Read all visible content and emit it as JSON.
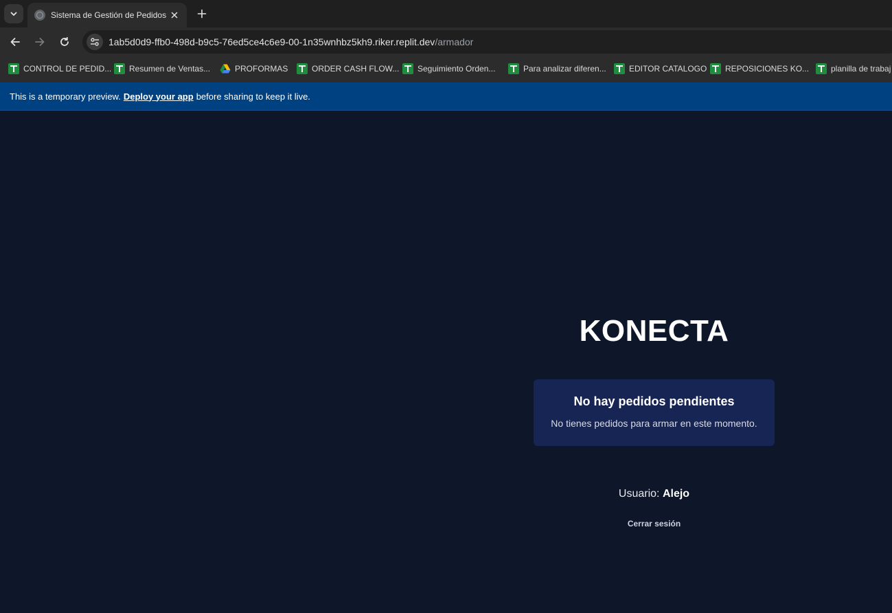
{
  "browser": {
    "tab": {
      "title": "Sistema de Gestión de Pedidos"
    },
    "address": {
      "host": "1ab5d0d9-ffb0-498d-b9c5-76ed5ce4c6e9-00-1n35wnhbz5kh9.riker.replit.dev",
      "path": "/armador"
    },
    "bookmarks": [
      {
        "label": "CONTROL DE PEDID...",
        "icon": "sheets-icon"
      },
      {
        "label": "Resumen de Ventas...",
        "icon": "sheets-icon"
      },
      {
        "label": "PROFORMAS",
        "icon": "drive-icon"
      },
      {
        "label": "ORDER CASH FLOW...",
        "icon": "sheets-icon"
      },
      {
        "label": "Seguimiento Orden...",
        "icon": "sheets-icon"
      },
      {
        "label": "Para analizar diferen...",
        "icon": "sheets-icon"
      },
      {
        "label": "EDITOR CATALOGO",
        "icon": "sheets-icon"
      },
      {
        "label": "REPOSICIONES KO...",
        "icon": "sheets-icon"
      },
      {
        "label": "planilla de trabaj",
        "icon": "sheets-icon"
      }
    ]
  },
  "banner": {
    "prefix": "This is a temporary preview.",
    "link": "Deploy your app",
    "suffix": "before sharing to keep it live."
  },
  "app": {
    "brand": "KONECTA",
    "empty_card": {
      "title": "No hay pedidos pendientes",
      "message": "No tienes pedidos para armar en este momento."
    },
    "user": {
      "label": "Usuario:",
      "name": "Alejo"
    },
    "logout_label": "Cerrar sesión"
  },
  "colors": {
    "page_background": "#0e1629",
    "card_background": "#172554",
    "banner_background": "#004182",
    "bookmark_sheet_green": "#1e8e3e"
  }
}
